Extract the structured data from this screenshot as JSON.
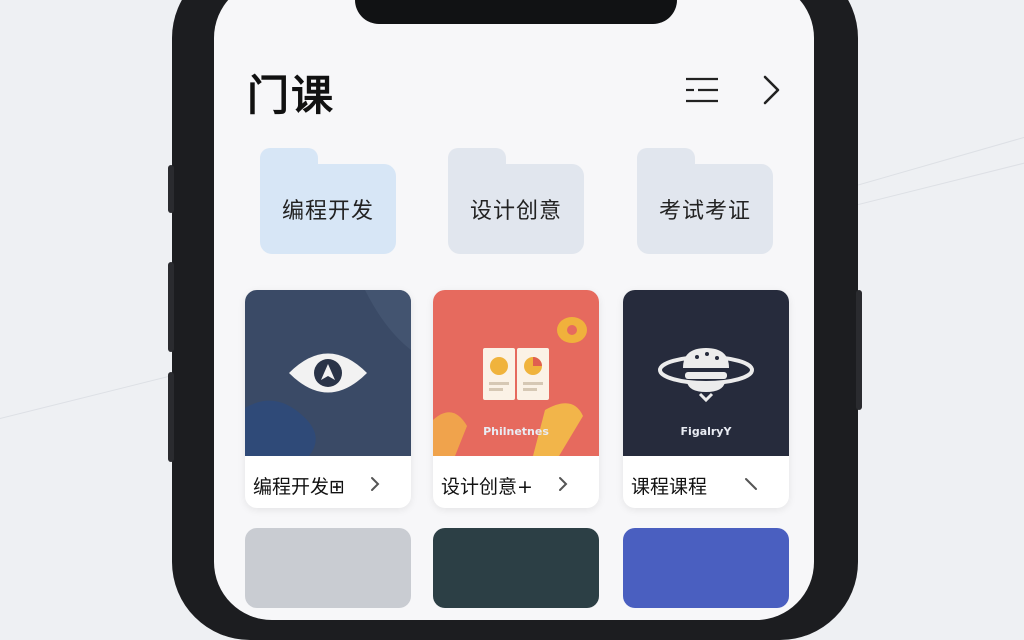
{
  "header": {
    "title": "门课",
    "filter_icon": "list-filter-icon",
    "next_icon": "chevron-right-icon"
  },
  "categories": [
    {
      "label": "编程开发",
      "color": "#d7e6f6"
    },
    {
      "label": "设计创意",
      "color": "#e1e6ee"
    },
    {
      "label": "考试考证",
      "color": "#e1e6ee"
    }
  ],
  "courses": [
    {
      "label": "编程开发⊞",
      "thumb_icon": "eye-icon",
      "arrow_icon": "chevron-right-icon"
    },
    {
      "label": "设计创意+",
      "thumb_icon": "open-book-icon",
      "thumb_caption": "Philnetnes",
      "arrow_icon": "chevron-right-icon"
    },
    {
      "label": "课程课程",
      "thumb_icon": "planet-burger-icon",
      "thumb_caption": "FigalryY",
      "arrow_icon": "chevron-down-right-icon"
    }
  ],
  "colors": {
    "card1_bg": "#3a4a66",
    "card2_bg": "#e66a5e",
    "card3_bg": "#262b3c",
    "row2_a": "#c9ccd2",
    "row2_b": "#2c3f45",
    "row2_c": "#4a5fc0"
  }
}
